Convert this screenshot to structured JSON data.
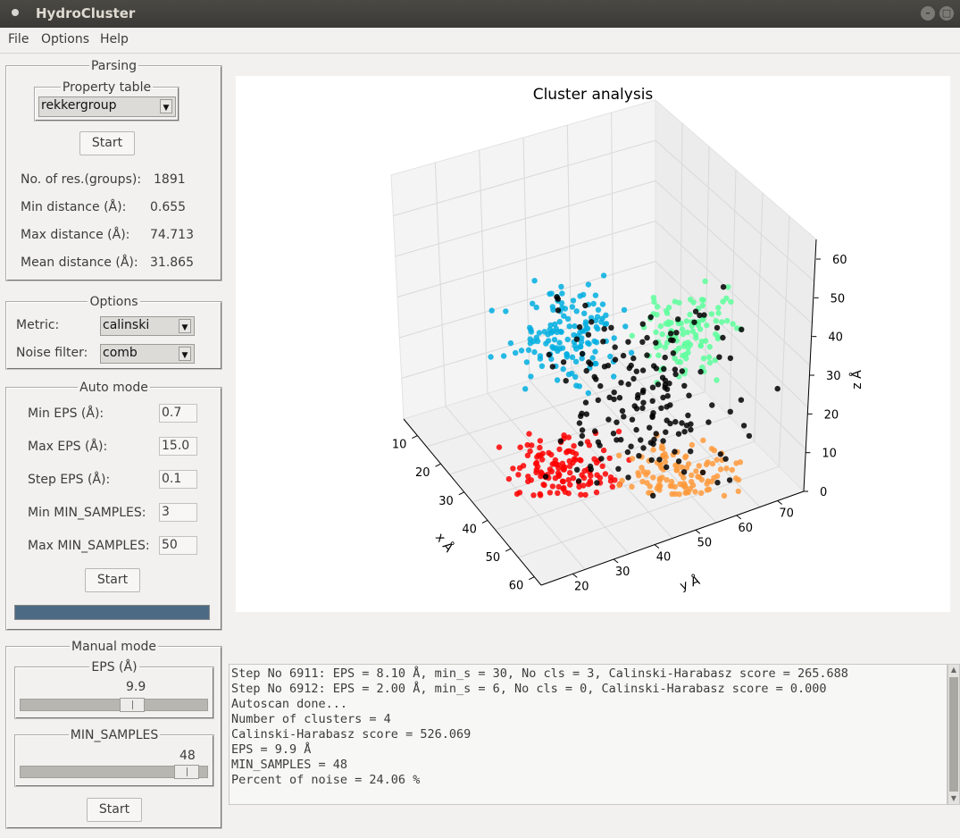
{
  "window": {
    "title": "HydroCluster"
  },
  "menu": [
    "File",
    "Options",
    "Help"
  ],
  "parsing": {
    "legend": "Parsing",
    "property_table": {
      "legend": "Property table",
      "value": "rekkergroup"
    },
    "start_label": "Start",
    "stats": [
      {
        "label": "No. of res.(groups):",
        "value": "1891"
      },
      {
        "label": "Min distance (Å):",
        "value": "0.655"
      },
      {
        "label": "Max distance (Å):",
        "value": "74.713"
      },
      {
        "label": "Mean distance (Å):",
        "value": "31.865"
      }
    ]
  },
  "options": {
    "legend": "Options",
    "metric_label": "Metric:",
    "metric_value": "calinski",
    "noise_label": "Noise filter:",
    "noise_value": "comb"
  },
  "auto_mode": {
    "legend": "Auto mode",
    "fields": [
      {
        "label": "Min EPS (Å):",
        "value": "0.7"
      },
      {
        "label": "Max EPS (Å):",
        "value": "15.0"
      },
      {
        "label": "Step EPS (Å):",
        "value": "0.1"
      },
      {
        "label": "Min MIN_SAMPLES:",
        "value": "3"
      },
      {
        "label": "Max MIN_SAMPLES:",
        "value": "50"
      }
    ],
    "start_label": "Start",
    "progress": 1.0
  },
  "manual_mode": {
    "legend": "Manual mode",
    "eps": {
      "legend": "EPS (Å)",
      "value": "9.9",
      "fraction": 0.62
    },
    "min_samples": {
      "legend": "MIN_SAMPLES",
      "value": "48",
      "fraction": 0.96
    },
    "start_label": "Start"
  },
  "chart_data": {
    "type": "scatter",
    "title": "Cluster analysis",
    "xlabel": "x Å",
    "ylabel": "y Å",
    "zlabel": "z Å",
    "x_ticks": [
      "10",
      "20",
      "30",
      "40",
      "50",
      "60"
    ],
    "y_ticks": [
      "20",
      "30",
      "40",
      "50",
      "60",
      "70"
    ],
    "z_ticks": [
      "0",
      "10",
      "20",
      "30",
      "40",
      "50",
      "60"
    ],
    "series": [
      {
        "color": "#00aee0",
        "region": "upper-left"
      },
      {
        "color": "#5dff9c",
        "region": "upper-right"
      },
      {
        "color": "#ff0000",
        "region": "lower-left"
      },
      {
        "color": "#ff9a3c",
        "region": "lower-right"
      },
      {
        "color": "#000000",
        "region": "noise"
      }
    ]
  },
  "log_lines": [
    "Step No 6911: EPS = 8.10 Å, min_s = 30, No cls = 3, Calinski-Harabasz score = 265.688",
    "Step No 6912: EPS = 2.00 Å, min_s = 6, No cls = 0, Calinski-Harabasz score = 0.000",
    "Autoscan done...",
    "Number of clusters = 4",
    "Calinski-Harabasz score = 526.069",
    "EPS = 9.9 Å",
    "MIN_SAMPLES = 48",
    "Percent of noise = 24.06 %"
  ]
}
